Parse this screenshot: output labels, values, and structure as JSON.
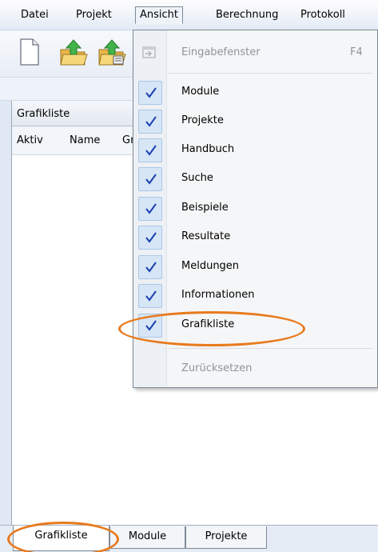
{
  "menubar": {
    "items": [
      "Datei",
      "Projekt",
      "Ansicht",
      "Berechnung",
      "Protokoll"
    ]
  },
  "panel": {
    "title": "Grafikliste",
    "columns": [
      "Aktiv",
      "Name",
      "Gr"
    ]
  },
  "dropdown": {
    "input_window": {
      "label": "Eingabefenster",
      "shortcut": "F4"
    },
    "items": [
      {
        "label": "Module",
        "checked": true
      },
      {
        "label": "Projekte",
        "checked": true
      },
      {
        "label": "Handbuch",
        "checked": true
      },
      {
        "label": "Suche",
        "checked": true
      },
      {
        "label": "Beispiele",
        "checked": true
      },
      {
        "label": "Resultate",
        "checked": true
      },
      {
        "label": "Meldungen",
        "checked": true
      },
      {
        "label": "Informationen",
        "checked": true
      },
      {
        "label": "Grafikliste",
        "checked": true
      }
    ],
    "reset": {
      "label": "Zurücksetzen"
    }
  },
  "tabs": [
    "Grafikliste",
    "Module",
    "Projekte"
  ],
  "colors": {
    "highlight": "#e87a1e",
    "check": "#1a3fb0"
  },
  "icons": {
    "toolbar": [
      "new-document-icon",
      "open-folder-icon",
      "open-project-icon"
    ],
    "check": "checkmark-icon"
  }
}
